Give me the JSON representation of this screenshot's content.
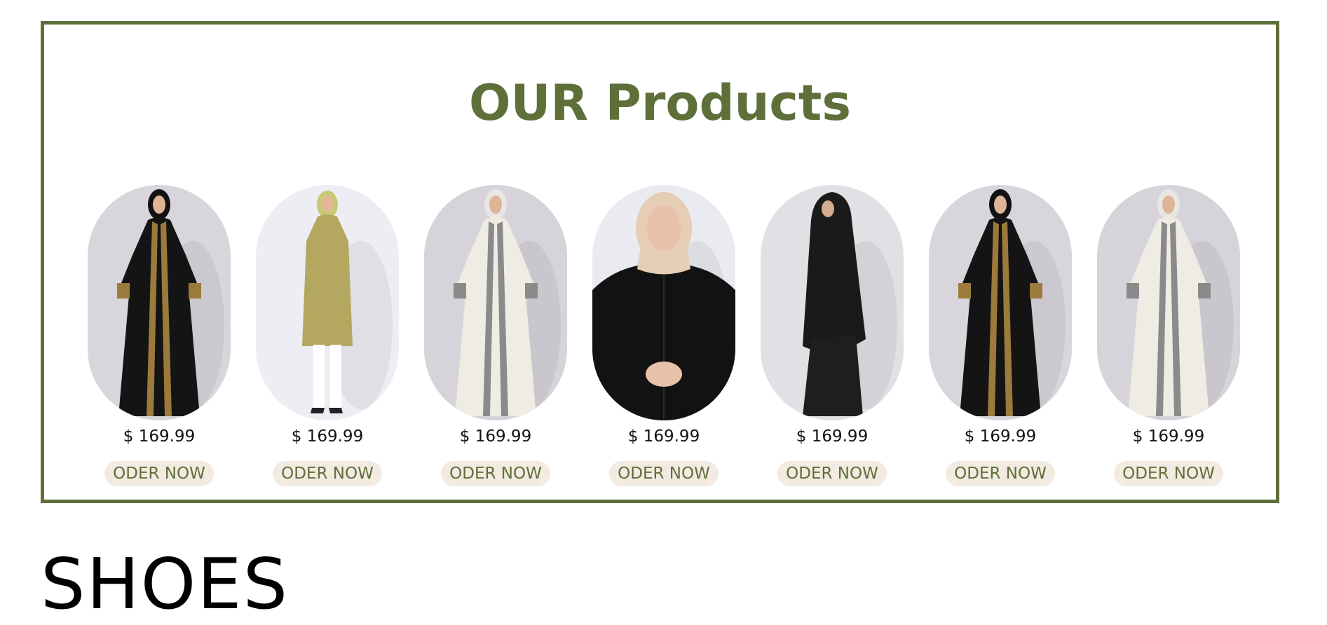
{
  "products_section": {
    "title": "OUR Products",
    "border_color": "#5f6f3a",
    "items": [
      {
        "price": "$ 169.99",
        "button_label": "ODER NOW",
        "garment": "black abaya with gold trim",
        "bg": "#d8d6dc",
        "dress": "#141414",
        "trim": "#9c7a3c",
        "hijab": "#111111"
      },
      {
        "price": "$ 169.99",
        "button_label": "ODER NOW",
        "garment": "olive tunic with white pants",
        "bg": "#eceef4",
        "dress": "#b4a860",
        "trim": "#b4a860",
        "hijab": "#c8c870"
      },
      {
        "price": "$ 169.99",
        "button_label": "ODER NOW",
        "garment": "white abaya with embroidery",
        "bg": "#d6d3da",
        "dress": "#efece4",
        "trim": "#8a8a8a",
        "hijab": "#e8e6e2"
      },
      {
        "price": "$ 169.99",
        "button_label": "ODER NOW",
        "garment": "black shirt with beige hijab",
        "bg": "#e9ebf1",
        "dress": "#121212",
        "trim": "#121212",
        "hijab": "#e6cdb6"
      },
      {
        "price": "$ 169.99",
        "button_label": "ODER NOW",
        "garment": "black khimar dress",
        "bg": "#e1e1e5",
        "dress": "#1e1e1e",
        "trim": "#1e1e1e",
        "hijab": "#1a1a1a"
      },
      {
        "price": "$ 169.99",
        "button_label": "ODER NOW",
        "garment": "black abaya with gold trim",
        "bg": "#d8d6dc",
        "dress": "#141414",
        "trim": "#9c7a3c",
        "hijab": "#111111"
      },
      {
        "price": "$ 169.99",
        "button_label": "ODER NOW",
        "garment": "white abaya with embroidery",
        "bg": "#d6d3da",
        "dress": "#efece4",
        "trim": "#8a8a8a",
        "hijab": "#e8e6e2"
      }
    ]
  },
  "shoes_section": {
    "title": "SHOES"
  },
  "colors": {
    "accent": "#5f6f3a",
    "button_bg": "#f3ebe1"
  }
}
